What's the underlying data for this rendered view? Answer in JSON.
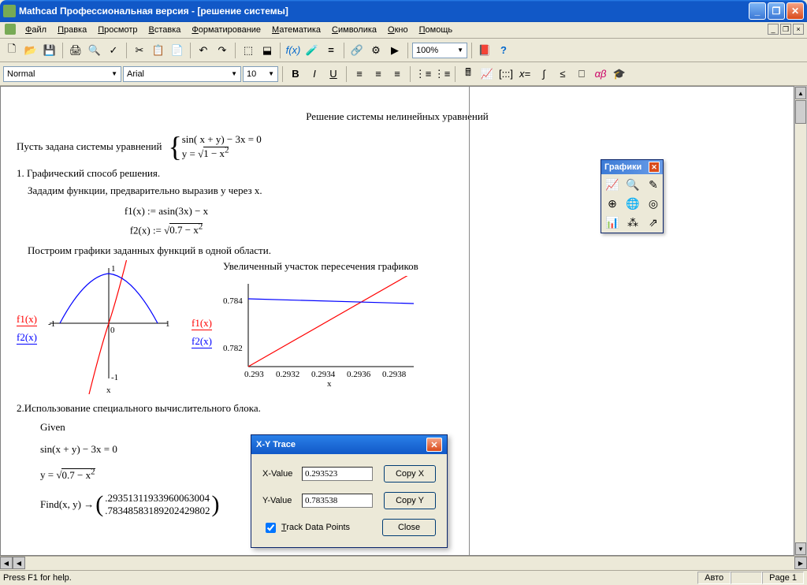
{
  "window": {
    "title": "Mathcad Профессиональная версия - [решение системы]"
  },
  "menu": {
    "items": [
      "Файл",
      "Правка",
      "Просмотр",
      "Вставка",
      "Форматирование",
      "Математика",
      "Символика",
      "Окно",
      "Помощь"
    ]
  },
  "toolbar1": {
    "zoom": "100%"
  },
  "toolbar2": {
    "style": "Normal",
    "font": "Arial",
    "size": "10"
  },
  "doc": {
    "title": "Решение системы нелинейных уравнений",
    "intro": "Пусть задана системы уравнений",
    "eq1": "sin( x + y) − 3x = 0",
    "eq2_lhs": "y = ",
    "eq2_rad": "1 − x",
    "sec1": "1. Графический способ решения.",
    "sec1a": "Зададим функции, предварительно выразив y через x.",
    "f1": "f1(x) := asin(3x) − x",
    "f2_lhs": "f2(x) := ",
    "f2_rad": "0.7 − x",
    "sec1b": "Построим графики заданных функций в одной области.",
    "chart2_title": "Увеличенный участок пересечения графиков",
    "sec2": "2.Использование специального вычислительного блока.",
    "given": "Given",
    "g1": "sin(x + y) − 3x = 0",
    "g2_lhs": "y = ",
    "g2_rad": "0.7 − x",
    "find_lhs": "Find(x, y) →",
    "find_r1": ".29351311933960063004",
    "find_r2": ".78348583189202429802"
  },
  "chart_data": [
    {
      "type": "line",
      "xlabel": "x",
      "series_labels": [
        "f1(x)",
        "f2(x)"
      ],
      "xlim": [
        -1,
        1
      ],
      "ylim": [
        -1,
        1
      ],
      "ticks_x": [
        -1,
        0,
        1
      ],
      "ticks_y": [
        -1,
        0,
        1
      ],
      "series": [
        {
          "name": "f1",
          "color": "#ff0000",
          "x": [
            -0.33,
            -0.2,
            -0.1,
            0,
            0.1,
            0.2,
            0.33
          ],
          "y": [
            -1.2,
            -0.44,
            -0.2,
            0,
            0.2,
            0.44,
            1.2
          ]
        },
        {
          "name": "f2",
          "color": "#0000ff",
          "x": [
            -0.83,
            -0.6,
            -0.3,
            0,
            0.3,
            0.6,
            0.83
          ],
          "y": [
            0,
            0.55,
            0.78,
            0.84,
            0.78,
            0.55,
            0
          ]
        }
      ]
    },
    {
      "type": "line",
      "xlabel": "x",
      "series_labels": [
        "f1(x)",
        "f2(x)"
      ],
      "xlim": [
        0.293,
        0.294
      ],
      "ylim": [
        0.781,
        0.7845
      ],
      "ticks_x": [
        0.293,
        0.2932,
        0.2934,
        0.2936,
        0.2938
      ],
      "ticks_y": [
        0.782,
        0.784
      ],
      "series": [
        {
          "name": "f1",
          "color": "#ff0000",
          "x": [
            0.293,
            0.294
          ],
          "y": [
            0.781,
            0.787
          ]
        },
        {
          "name": "f2",
          "color": "#0000ff",
          "x": [
            0.293,
            0.294
          ],
          "y": [
            0.7836,
            0.7833
          ]
        }
      ]
    }
  ],
  "graphpanel": {
    "title": "Графики"
  },
  "trace_dialog": {
    "title": "X-Y Trace",
    "xlabel": "X-Value",
    "ylabel": "Y-Value",
    "xval": "0.293523",
    "yval": "0.783538",
    "track": "Track Data Points",
    "copyx": "Copy X",
    "copyy": "Copy Y",
    "close": "Close"
  },
  "status": {
    "help": "Press F1 for help.",
    "auto": "Авто",
    "page": "Page 1"
  }
}
